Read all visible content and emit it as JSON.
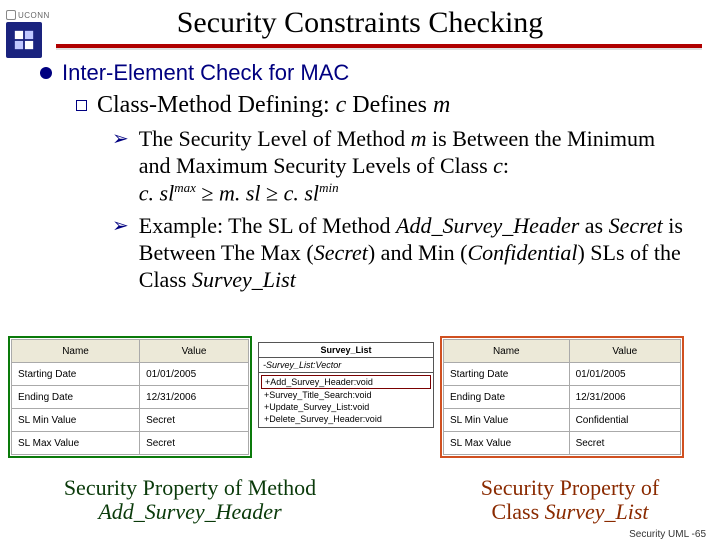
{
  "logo": {
    "uconn": "UCONN"
  },
  "title": "Security Constraints Checking",
  "bullets": {
    "level1": "Inter-Element Check for MAC",
    "level2_pre": "Class-Method Defining: ",
    "level2_c": "c",
    "level2_mid": " Defines ",
    "level2_m": "m",
    "p1a": "The Security Level of Method ",
    "p1b": "m",
    "p1c": " is Between the Minimum and Maximum Security Levels of Class ",
    "p1d": "c",
    "p1e": ":",
    "expr_c1": "c. sl",
    "expr_max": "max",
    "expr_ge1": " ≥ ",
    "expr_m": "m. sl",
    "expr_ge2": " ≥ ",
    "expr_c2": "c. sl",
    "expr_min": "min",
    "p2a": "Example: The SL of Method ",
    "p2b": "Add_Survey_Header",
    "p2c": " as ",
    "p2d": "Secret",
    "p2e": " is Between The Max (",
    "p2f": "Secret",
    "p2g": ") and Min (",
    "p2h": "Confidential",
    "p2i": ") SLs of the Class ",
    "p2j": "Survey_List"
  },
  "headers": {
    "name": "Name",
    "value": "Value"
  },
  "left_table": [
    {
      "n": "Starting Date",
      "v": "01/01/2005"
    },
    {
      "n": "Ending Date",
      "v": "12/31/2006"
    },
    {
      "n": "SL Min Value",
      "v": "Secret"
    },
    {
      "n": "SL Max Value",
      "v": "Secret"
    }
  ],
  "right_table": [
    {
      "n": "Starting Date",
      "v": "01/01/2005"
    },
    {
      "n": "Ending Date",
      "v": "12/31/2006"
    },
    {
      "n": "SL Min Value",
      "v": "Confidential"
    },
    {
      "n": "SL Max Value",
      "v": "Secret"
    }
  ],
  "uml": {
    "title": "Survey_List",
    "attr": "-Survey_List:Vector",
    "methods": [
      "+Add_Survey_Header:void",
      "+Survey_Title_Search:void",
      "+Update_Survey_List:void",
      "+Delete_Survey_Header:void"
    ]
  },
  "captions": {
    "left1": "Security Property of Method",
    "left2": "Add_Survey_Header",
    "right1": "Security Property of",
    "right2_a": "Class ",
    "right2_b": "Survey_List"
  },
  "footer": "Security UML -65"
}
